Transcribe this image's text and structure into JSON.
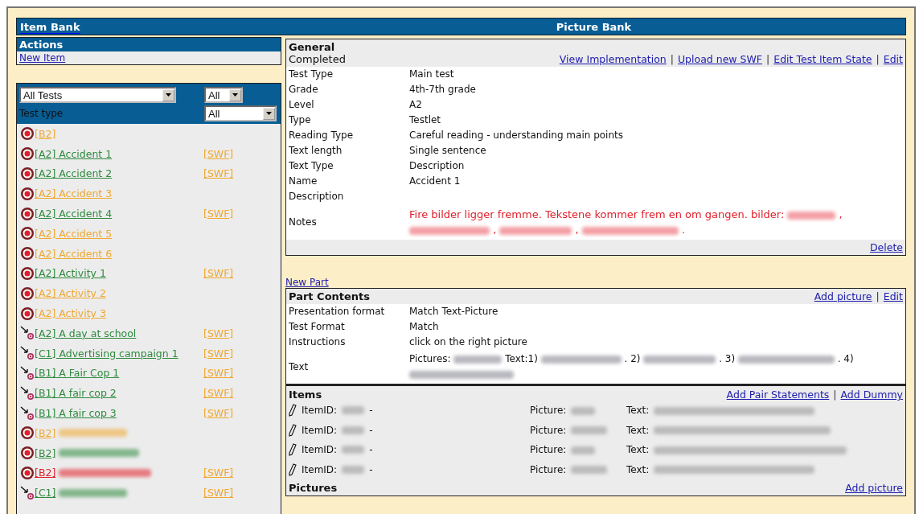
{
  "header": {
    "left_title": "Item Bank",
    "right_title": "Picture Bank"
  },
  "actions": {
    "title": "Actions",
    "links": [
      "New Item"
    ]
  },
  "filters": {
    "test_select": "All Tests",
    "level_select": "All",
    "type_label": "Test type",
    "type_select": "All"
  },
  "items": [
    {
      "kind": "target",
      "label": "[B2]",
      "color": "#f0a830",
      "redacted": false
    },
    {
      "kind": "target",
      "label": "[A2] Accident 1",
      "color": "#2e8b3e",
      "swf": "[SWF]",
      "redacted": false
    },
    {
      "kind": "target",
      "label": "[A2] Accident 2",
      "color": "#2e8b3e",
      "swf": "[SWF]",
      "redacted": false
    },
    {
      "kind": "target",
      "label": "[A2] Accident 3",
      "color": "#f0a830",
      "redacted": false
    },
    {
      "kind": "target",
      "label": "[A2] Accident 4",
      "color": "#2e8b3e",
      "swf": "[SWF]",
      "redacted": false
    },
    {
      "kind": "target",
      "label": "[A2] Accident 5",
      "color": "#f0a830",
      "redacted": false
    },
    {
      "kind": "target",
      "label": "[A2] Accident 6",
      "color": "#f0a830",
      "redacted": false
    },
    {
      "kind": "target",
      "label": "[A2] Activity 1",
      "color": "#2e8b3e",
      "swf": "[SWF]",
      "redacted": false
    },
    {
      "kind": "target",
      "label": "[A2] Activity 2",
      "color": "#f0a830",
      "redacted": false
    },
    {
      "kind": "target",
      "label": "[A2] Activity 3",
      "color": "#f0a830",
      "redacted": false
    },
    {
      "kind": "arrow",
      "label": "[A2] A day at school",
      "color": "#2e8b3e",
      "swf": "[SWF]",
      "redacted": false
    },
    {
      "kind": "arrow",
      "label": "[C1] Advertising campaign 1",
      "color": "#2e8b3e",
      "swf": "[SWF]",
      "redacted": false
    },
    {
      "kind": "arrow",
      "label": "[B1] A Fair Cop 1",
      "color": "#2e8b3e",
      "swf": "[SWF]",
      "redacted": false
    },
    {
      "kind": "arrow",
      "label": "[B1] A fair cop 2",
      "color": "#2e8b3e",
      "swf": "[SWF]",
      "redacted": false
    },
    {
      "kind": "arrow",
      "label": "[B1] A fair cop 3",
      "color": "#2e8b3e",
      "swf": "[SWF]",
      "redacted": false
    },
    {
      "kind": "target",
      "label": "[B2]",
      "color": "#f0a830",
      "redacted": true
    },
    {
      "kind": "target",
      "label": "[B2]",
      "color": "#2e8b3e",
      "redacted": true
    },
    {
      "kind": "target",
      "label": "[B2]",
      "color": "#e0202a",
      "swf": "[SWF]",
      "redacted": true
    },
    {
      "kind": "arrow",
      "label": "[C1]",
      "color": "#2e8b3e",
      "swf": "[SWF]",
      "redacted": true
    }
  ],
  "link_separator": "|",
  "general": {
    "title": "General",
    "status": "Completed",
    "links": [
      "View Implementation",
      "Upload new SWF",
      "Edit Test Item State",
      "Edit"
    ],
    "fields": [
      {
        "label": "Test Type",
        "value": "Main test"
      },
      {
        "label": "Grade",
        "value": "4th-7th grade"
      },
      {
        "label": "Level",
        "value": "A2"
      },
      {
        "label": "Type",
        "value": "Testlet"
      },
      {
        "label": "Reading Type",
        "value": "Careful reading - understanding main points"
      },
      {
        "label": "Text length",
        "value": "Single sentence"
      },
      {
        "label": "Text Type",
        "value": "Description"
      },
      {
        "label": "Name",
        "value": "Accident 1"
      },
      {
        "label": "Description"
      }
    ],
    "notes": {
      "label": "Notes",
      "segments": [
        {
          "kind": "text",
          "text": "Fire bilder ligger fremme. Tekstene kommer frem en om gangen. bilder:"
        },
        {
          "kind": "blur"
        },
        {
          "kind": "text",
          "text": ","
        },
        {
          "kind": "blur"
        },
        {
          "kind": "text",
          "text": ","
        },
        {
          "kind": "blur"
        },
        {
          "kind": "text",
          "text": ","
        },
        {
          "kind": "blur"
        },
        {
          "kind": "text",
          "text": "."
        }
      ]
    },
    "footer_link": "Delete"
  },
  "new_part": "New Part",
  "part": {
    "title": "Part Contents",
    "links": [
      "Add picture",
      "Edit"
    ],
    "fields": [
      {
        "label": "Presentation format",
        "value": "Match Text-Picture"
      },
      {
        "label": "Test Format",
        "value": "Match"
      },
      {
        "label": "Instructions",
        "value": "click on the right picture"
      }
    ],
    "text": {
      "label": "Text",
      "segments": [
        {
          "kind": "text",
          "text": "Pictures:"
        },
        {
          "kind": "blur"
        },
        {
          "kind": "text",
          "text": "Text:1)"
        },
        {
          "kind": "blur"
        },
        {
          "kind": "text",
          "text": ". 2)"
        },
        {
          "kind": "blur"
        },
        {
          "kind": "text",
          "text": ". 3)"
        },
        {
          "kind": "blur"
        },
        {
          "kind": "text",
          "text": ". 4)"
        },
        {
          "kind": "blur"
        }
      ]
    }
  },
  "items_section": {
    "title": "Items",
    "links": [
      "Add Pair Statements",
      "Add Dummy"
    ],
    "rows": [
      {
        "id_label": "ItemID:",
        "dash": "-",
        "picture_label": "Picture:",
        "text_label": "Text:"
      },
      {
        "id_label": "ItemID:",
        "dash": "-",
        "picture_label": "Picture:",
        "text_label": "Text:"
      },
      {
        "id_label": "ItemID:",
        "dash": "-",
        "picture_label": "Picture:",
        "text_label": "Text:"
      },
      {
        "id_label": "ItemID:",
        "dash": "-",
        "picture_label": "Picture:",
        "text_label": "Text:"
      }
    ]
  },
  "pictures_section": {
    "title": "Pictures",
    "links": [
      "Add picture"
    ]
  }
}
